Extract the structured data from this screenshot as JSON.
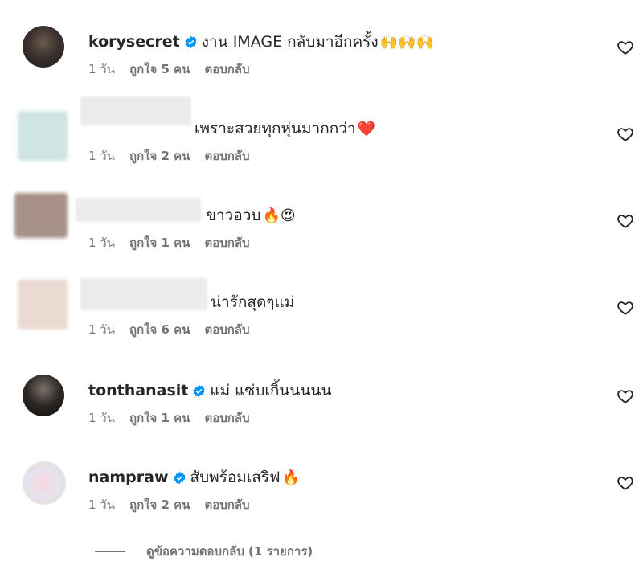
{
  "comments": [
    {
      "username": "korysecret",
      "verified": true,
      "text": "งาน IMAGE กลับมาอีกครั้ง",
      "emoji": "🙌🙌🙌",
      "time": "1 วัน",
      "likes": "ถูกใจ 5 คน",
      "reply": "ตอบกลับ",
      "avatar": "avatar-photo"
    },
    {
      "username": "",
      "verified": false,
      "text": "เพราะสวยทุกหุ่นมากกว่า",
      "emoji": "❤️",
      "time": "1 วัน",
      "likes": "ถูกใจ 2 คน",
      "reply": "ตอบกลับ",
      "avatar": "blurred-avatar"
    },
    {
      "username": "",
      "verified": false,
      "text": "ขาวอวบ",
      "emoji": "🔥😍",
      "time": "1 วัน",
      "likes": "ถูกใจ 1 คน",
      "reply": "ตอบกลับ",
      "avatar": "blurred-avatar"
    },
    {
      "username": "",
      "verified": false,
      "text": "น่ารักสุดๆแม่",
      "emoji": "",
      "time": "1 วัน",
      "likes": "ถูกใจ 6 คน",
      "reply": "ตอบกลับ",
      "avatar": "blurred-avatar"
    },
    {
      "username": "tonthanasit",
      "verified": true,
      "text": "แม่ แซ่บเกิ้นนนนน",
      "emoji": "",
      "time": "1 วัน",
      "likes": "ถูกใจ 1 คน",
      "reply": "ตอบกลับ",
      "avatar": "avatar-photo"
    },
    {
      "username": "nampraw",
      "verified": true,
      "text": "สับพร้อมเสริฟ",
      "emoji": "🔥",
      "time": "1 วัน",
      "likes": "ถูกใจ 2 คน",
      "reply": "ตอบกลับ",
      "avatar": "avatar-photo"
    }
  ],
  "view_replies": "ดูข้อความตอบกลับ (1 รายการ)",
  "colors": {
    "verified_badge": "#0095f6",
    "meta_text": "#737373",
    "text": "#262626"
  },
  "icons": {
    "like": "heart-outline-icon",
    "verified": "verified-badge-icon"
  }
}
